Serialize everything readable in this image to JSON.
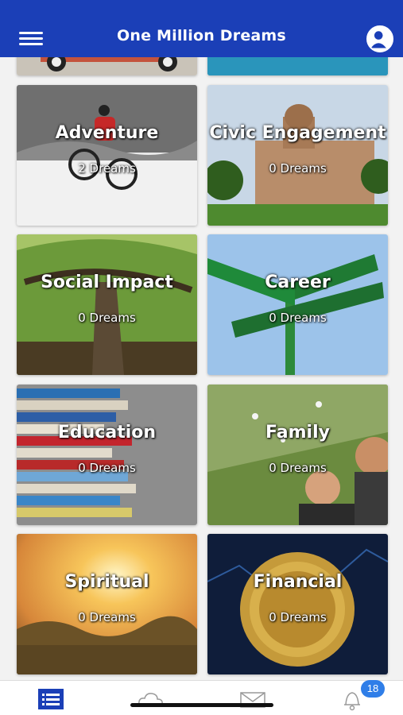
{
  "header": {
    "title": "One Million Dreams"
  },
  "categories": [
    {
      "name": "Adventure",
      "count": "2 Dreams"
    },
    {
      "name": "Civic Engagement",
      "count": "0 Dreams"
    },
    {
      "name": "Social Impact",
      "count": "0 Dreams"
    },
    {
      "name": "Career",
      "count": "0 Dreams"
    },
    {
      "name": "Education",
      "count": "0 Dreams"
    },
    {
      "name": "Family",
      "count": "0 Dreams"
    },
    {
      "name": "Spiritual",
      "count": "0 Dreams"
    },
    {
      "name": "Financial",
      "count": "0 Dreams"
    }
  ],
  "tabbar": {
    "tabs": [
      {
        "icon": "list-icon",
        "active": true
      },
      {
        "icon": "cloud-icon",
        "active": false
      },
      {
        "icon": "mail-icon",
        "active": false
      },
      {
        "icon": "bell-icon",
        "active": false
      }
    ],
    "notification_count": "18"
  },
  "colors": {
    "header": "#1b3fb7",
    "active_tab": "#1b3fb7",
    "badge": "#2f7ee8"
  }
}
